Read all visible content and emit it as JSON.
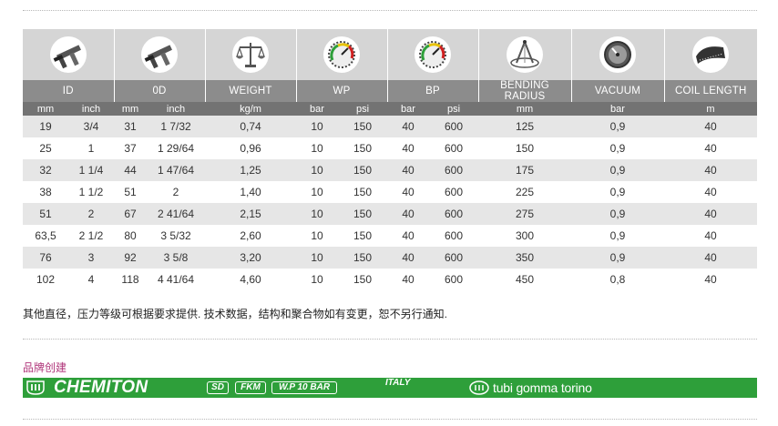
{
  "table": {
    "icons": [
      "caliper-icon",
      "caliper-icon",
      "balance-scale-icon",
      "pressure-gauge-icon",
      "pressure-gauge-icon",
      "bending-radius-icon",
      "vacuum-gauge-icon",
      "coil-ruler-icon"
    ],
    "headers": [
      "ID",
      "0D",
      "WEIGHT",
      "WP",
      "BP",
      "BENDING RADIUS",
      "VACUUM",
      "COIL LENGTH"
    ],
    "units": [
      "mm",
      "inch",
      "mm",
      "inch",
      "kg/m",
      "bar",
      "psi",
      "bar",
      "psi",
      "mm",
      "bar",
      "m"
    ],
    "rows": [
      [
        "19",
        "3/4",
        "31",
        "1 7/32",
        "0,74",
        "10",
        "150",
        "40",
        "600",
        "125",
        "0,9",
        "40"
      ],
      [
        "25",
        "1",
        "37",
        "1 29/64",
        "0,96",
        "10",
        "150",
        "40",
        "600",
        "150",
        "0,9",
        "40"
      ],
      [
        "32",
        "1 1/4",
        "44",
        "1 47/64",
        "1,25",
        "10",
        "150",
        "40",
        "600",
        "175",
        "0,9",
        "40"
      ],
      [
        "38",
        "1 1/2",
        "51",
        "2",
        "1,40",
        "10",
        "150",
        "40",
        "600",
        "225",
        "0,9",
        "40"
      ],
      [
        "51",
        "2",
        "67",
        "2 41/64",
        "2,15",
        "10",
        "150",
        "40",
        "600",
        "275",
        "0,9",
        "40"
      ],
      [
        "63,5",
        "2 1/2",
        "80",
        "3 5/32",
        "2,60",
        "10",
        "150",
        "40",
        "600",
        "300",
        "0,9",
        "40"
      ],
      [
        "76",
        "3",
        "92",
        "3 5/8",
        "3,20",
        "10",
        "150",
        "40",
        "600",
        "350",
        "0,9",
        "40"
      ],
      [
        "102",
        "4",
        "118",
        "4 41/64",
        "4,60",
        "10",
        "150",
        "40",
        "600",
        "450",
        "0,8",
        "40"
      ]
    ]
  },
  "note": "其他直径，压力等级可根据要求提供. 技术数据，结构和聚合物如有变更，恕不另行通知.",
  "brand": {
    "label": "品牌创建",
    "name": "CHEMITON",
    "tags": [
      "SD",
      "FKM",
      "W.P 10 BAR"
    ],
    "origin": "ITALY",
    "maker": "tubi gomma torino"
  },
  "colors": {
    "brand_bar": "#2e9f3a",
    "brand_label": "#b0357a",
    "header": "#8c8c8c",
    "units": "#737373",
    "icon_bg": "#d5d5d5",
    "row_shade": "#e6e6e6"
  }
}
